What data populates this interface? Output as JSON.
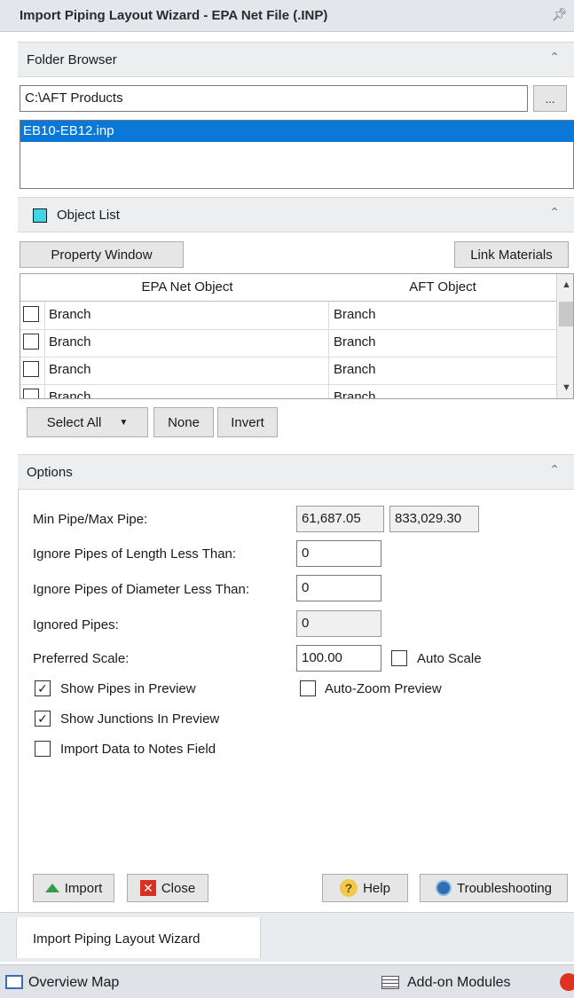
{
  "window": {
    "title": "Import Piping Layout Wizard - EPA Net File (.INP)",
    "pin_icon": "pin-icon"
  },
  "folder_browser": {
    "header": "Folder Browser",
    "path": "C:\\AFT Products",
    "browse_label": "...",
    "files": [
      "EB10-EB12.inp"
    ],
    "selected_file": "EB10-EB12.inp"
  },
  "object_list": {
    "header": "Object List",
    "property_window_label": "Property Window",
    "link_materials_label": "Link Materials",
    "columns": [
      "EPA Net Object",
      "AFT Object"
    ],
    "rows": [
      {
        "epa": "Branch",
        "aft": "Branch"
      },
      {
        "epa": "Branch",
        "aft": "Branch"
      },
      {
        "epa": "Branch",
        "aft": "Branch"
      },
      {
        "epa": "Branch",
        "aft": "Branch"
      }
    ],
    "select_all_label": "Select All",
    "none_label": "None",
    "invert_label": "Invert",
    "accent_color": "#3fd6e8"
  },
  "options": {
    "header": "Options",
    "min_max_label": "Min Pipe/Max Pipe:",
    "min_pipe": "61,687.05",
    "max_pipe": "833,029.30",
    "ignore_length_label": "Ignore Pipes of Length Less Than:",
    "ignore_length_value": "0",
    "ignore_diameter_label": "Ignore Pipes of Diameter Less Than:",
    "ignore_diameter_value": "0",
    "ignored_pipes_label": "Ignored Pipes:",
    "ignored_pipes_value": "0",
    "preferred_scale_label": "Preferred Scale:",
    "preferred_scale_value": "100.00",
    "auto_scale_label": "Auto Scale",
    "show_pipes_label": "Show Pipes in Preview",
    "auto_zoom_label": "Auto-Zoom Preview",
    "show_junctions_label": "Show Junctions In Preview",
    "import_notes_label": "Import Data to Notes Field",
    "show_pipes_checked": true,
    "show_junctions_checked": true,
    "auto_scale_checked": false,
    "auto_zoom_checked": false,
    "import_notes_checked": false
  },
  "actions": {
    "import_label": "Import",
    "close_label": "Close",
    "help_label": "Help",
    "troubleshooting_label": "Troubleshooting"
  },
  "tabs": {
    "active": "Import Piping Layout Wizard"
  },
  "status_bar": {
    "overview_map_label": "Overview Map",
    "addon_modules_label": "Add-on Modules"
  }
}
